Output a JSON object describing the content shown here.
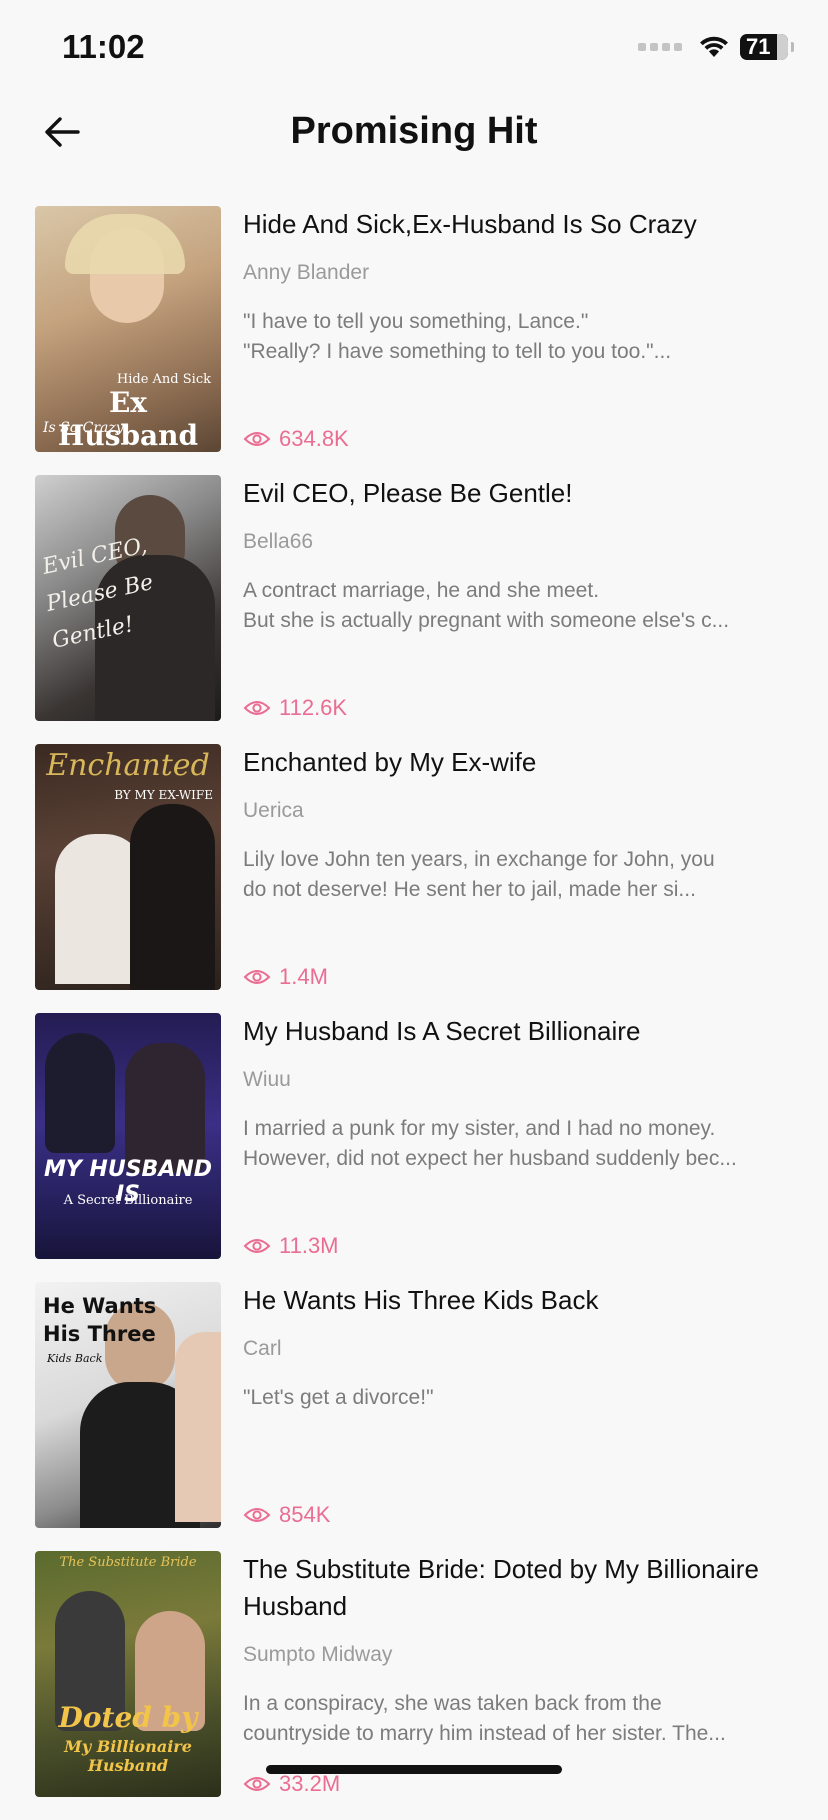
{
  "status": {
    "time": "11:02",
    "battery": "71"
  },
  "header": {
    "title": "Promising Hit"
  },
  "books": [
    {
      "title": "Hide And Sick,Ex-Husband Is So Crazy",
      "author": "Anny Blander",
      "desc1": "\"I have to tell you something, Lance.\"",
      "desc2": "\"Really? I have something to tell to you too.\"...",
      "views": "634.8K",
      "cover_text1": "Hide And Sick",
      "cover_text2": "Ex Husband",
      "cover_text3": "Is So Crazy"
    },
    {
      "title": "Evil CEO, Please Be Gentle!",
      "author": "Bella66",
      "desc1": "A contract marriage, he and she meet.",
      "desc2": "But she is actually pregnant with someone else's c...",
      "views": "112.6K",
      "cover_text1": "Evil CEO,",
      "cover_text2": "Please Be",
      "cover_text3": "Gentle!"
    },
    {
      "title": "Enchanted by My Ex-wife",
      "author": "Uerica",
      "desc1": "Lily love John ten years, in exchange for John, you",
      "desc2": "do not deserve! He sent her to jail, made her si...",
      "views": "1.4M",
      "cover_text1": "Enchanted",
      "cover_text2": "BY MY EX-WIFE",
      "cover_text3": ""
    },
    {
      "title": "My Husband Is A Secret Billionaire",
      "author": "Wiuu",
      "desc1": "I married a punk for my sister, and I had no money.",
      "desc2": "However, did not expect her husband suddenly bec...",
      "views": "11.3M",
      "cover_text1": "MY HUSBAND IS",
      "cover_text2": "A Secret Billionaire",
      "cover_text3": ""
    },
    {
      "title": "He Wants His Three Kids Back",
      "author": "Carl",
      "desc1": "\"Let's get a divorce!\"",
      "desc2": "",
      "views": "854K",
      "cover_text1": "He Wants",
      "cover_text2": "His Three",
      "cover_text3": "Kids Back"
    },
    {
      "title": "The Substitute Bride: Doted by My Billionaire Husband",
      "author": "Sumpto Midway",
      "desc1": "In a conspiracy, she was taken back from the",
      "desc2": "countryside to marry him instead of her sister. The...",
      "views": "33.2M",
      "cover_text1": "The Substitute Bride",
      "cover_text2": "Doted by",
      "cover_text3": "My Billionaire Husband"
    }
  ],
  "colors": {
    "accent": "#ea6d93",
    "background": "#f8f8f8"
  },
  "icons": {
    "back": "arrow-left-icon",
    "views": "eye-icon",
    "wifi": "wifi-icon",
    "battery": "battery-icon"
  }
}
